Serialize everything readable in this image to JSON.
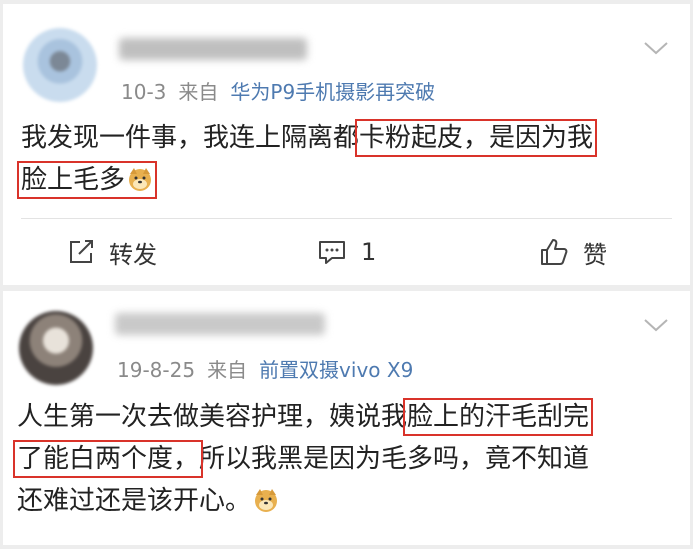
{
  "posts": [
    {
      "meta": {
        "date": "10-3",
        "from_label": "来自",
        "source": "华为P9手机摄影再突破"
      },
      "lines": [
        {
          "before": "我发现一件事，我连上隔离都",
          "highlight": "卡粉起皮，是因为我",
          "after": ""
        },
        {
          "before": "",
          "highlight": "脸上毛多",
          "after": ""
        }
      ],
      "actions": {
        "repost": "转发",
        "comment": "1",
        "like": "赞"
      }
    },
    {
      "meta": {
        "date": "19-8-25",
        "from_label": "来自",
        "source": "前置双摄vivo X9"
      },
      "lines": [
        {
          "before": "人生第一次去做美容护理，姨说我",
          "highlight": "脸上的汗毛刮完",
          "after": ""
        },
        {
          "before": "",
          "highlight": "了能白两个度，",
          "after": "所以我黑是因为毛多吗，竟不知道"
        },
        {
          "before": "还难过还是该开心。",
          "highlight": "",
          "after": ""
        }
      ]
    }
  ],
  "icons": [
    "chevron-down-icon",
    "repost-icon",
    "comment-icon",
    "like-icon",
    "doge-emoji-icon"
  ],
  "colors": {
    "highlight_box": "#d9332a",
    "source_link": "#4e7ab0",
    "meta_text": "#8a8a8a"
  }
}
